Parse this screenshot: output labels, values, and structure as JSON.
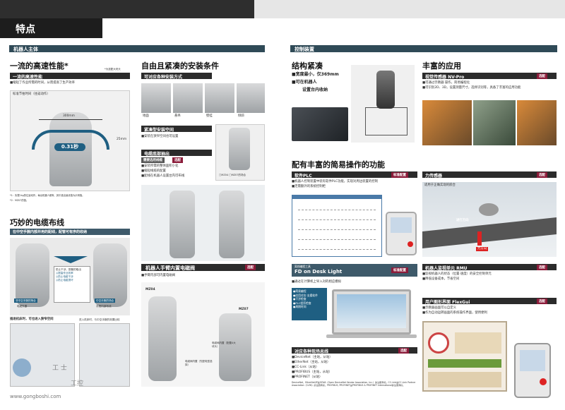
{
  "page_title": "特点",
  "sections": {
    "robot_body": "机器人主体",
    "controller": "控制装置"
  },
  "left": {
    "speed": {
      "heading": "一流的高速性能*",
      "note_top": "*为选配大块头",
      "subheading": "一流的高速性能",
      "text": "■缩短了作业所需的时间，从而提高了生产效率",
      "diagram_title": "标准节拍时间（往返动作）",
      "dim_width": "300mm",
      "dim_height": "25mm",
      "time_badge": "0.31秒",
      "footnote1": "*1：负载1kg的往返动作。每台机器人都有，其中选出最优值为示例值。",
      "footnote2": "*2：MZ07的值。"
    },
    "cable": {
      "heading": "巧妙的电缆布线",
      "subheading": "在中空手腕内部并用的配线，配管可有序的收纳",
      "label_left": "非中空手腕的场合",
      "label_left2": "电缆外露",
      "label_right": "中空手腕的场合",
      "label_right2": "手腕内部布线",
      "mid_label": "防止干涉，配管的取出",
      "mid_points": [
        "◎提高作业效率",
        "◎防止电缆干涉",
        "◎防止电缆损坏"
      ],
      "cap1": "插进机床时，可也进入狭窄空间",
      "cap2": "进入机床时，与中空手腕的效果比较"
    },
    "install": {
      "heading": "自由且紧凑的安装条件",
      "sub1": "可对应各种安装方式",
      "labels": [
        "地面",
        "悬吊",
        "壁挂",
        "倾斜"
      ],
      "sub2": "紧凑型安装空间",
      "sub2_text": "■安装在狭窄空间也可设置",
      "sub3": "电缆底部抽出",
      "sub3_tag": "需要选用线缆",
      "sub3_opt": "选配",
      "sub3_items": [
        "■安装所需的整体面积小化",
        "■缩短线缆的配置",
        "■配线在机器人设置台内可布线"
      ],
      "legend": "□MZ04  □MZ07的场合"
    },
    "handcable": {
      "heading": "机器人手臂内置电磁阀",
      "opt": "选配",
      "text": "■手臂内部可内置电磁阀",
      "model1": "MZ04",
      "model2": "MZ07",
      "note1": "电磁阀内置（先配电型选择）",
      "note2": "电磁阀内置（配置4大块头）"
    }
  },
  "right": {
    "compact": {
      "heading": "结构紧凑",
      "items": [
        "■宽度最小，仅369mm",
        "■可在机器人",
        "设置台内收纳"
      ]
    },
    "apps": {
      "heading": "丰富的应用",
      "sub": "视觉传感器 NV-Pro",
      "opt": "选配",
      "items": [
        "■可通过示教器 操作，简易编程化",
        "■可识别2D、3D，设置测量尺寸，选择识别等，具备了丰富的应用功能"
      ]
    },
    "ops": {
      "heading": "配有丰富的简易操作的功能",
      "softplc": {
        "sub": "软件PLC",
        "tag": "标准配置",
        "items": [
          "■机器人控制装置中装有软件PLC功能，实现对周边装置的控制",
          "■无需额外的系统控制柜"
        ]
      },
      "force": {
        "sub": "力传感器",
        "tag": "选配",
        "caption": "适用于正确实现的嵌合",
        "arrow1": "进行方向",
        "arrow2": "力方向"
      },
      "fd": {
        "small": "离线编程工具",
        "sub": "FD on Desk Light",
        "tag": "标准配置",
        "text": "■通过在计算机上导入对的相应模拟",
        "list": [
          "●简易编程",
          "●应用对应·支援软件",
          "●干涉检查",
          "●PLC程序检查",
          "●周期时间"
        ]
      },
      "rmu": {
        "sub": "机器人监视单元 RMU",
        "tag": "选配",
        "items": [
          "■监视机器人的状态（位置·速度）的安全控制单元",
          "■降低设备成本，节省空间"
        ]
      },
      "flexgui": {
        "sub": "用户图形界面 FlexGui",
        "tag": "选配",
        "items": [
          "■示教器画面可以自定义",
          "■作为自动运转画面的系统操作界面，使用便利"
        ]
      },
      "fieldbus": {
        "sub": "对应各种现场总线",
        "tag": "选配",
        "items": [
          "■DeviceNet（主站，从站）",
          "■EtherNet（主站，从站）",
          "■CC-Link（从站）",
          "■PROFIBUS（主站，从站）",
          "■PROFINET（从站）"
        ],
        "footnote": "DeviceNet，EtherNet/IP是ODVA（Open DeviceNet Vendor Association, Inc.）的注册商标。CC-Link是CC-Link Partner Association（CLPA）的注册商标。PROFIBUS, PROFINET是PROFIBUS & PROFINET International的注册商标。"
      }
    }
  },
  "watermark": {
    "text1": "工 士",
    "text2": "工控",
    "url": "www.gongboshi.com"
  },
  "colors": {
    "section_bar": "#2f4a57",
    "tag": "#8b1c3a",
    "header": "#2e2e2e"
  }
}
